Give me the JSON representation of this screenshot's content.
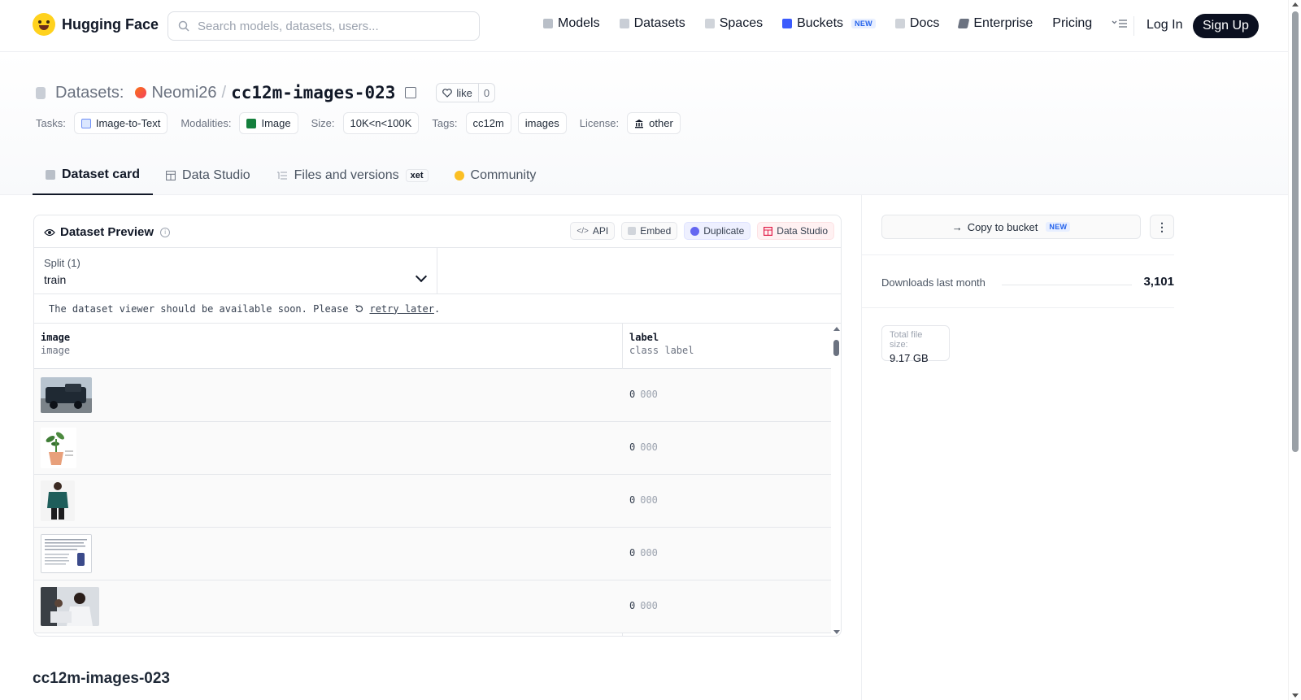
{
  "nav": {
    "brand": "Hugging Face",
    "search_placeholder": "Search models, datasets, users...",
    "links": {
      "models": "Models",
      "datasets": "Datasets",
      "spaces": "Spaces",
      "buckets": "Buckets",
      "buckets_badge": "NEW",
      "docs": "Docs",
      "enterprise": "Enterprise",
      "pricing": "Pricing"
    },
    "login": "Log In",
    "signup": "Sign Up"
  },
  "repo": {
    "type_label": "Datasets:",
    "owner": "Neomi26",
    "separator": "/",
    "name": "cc12m-images-023",
    "like_label": "like",
    "like_count": "0"
  },
  "meta": {
    "tasks_label": "Tasks:",
    "task": "Image-to-Text",
    "modalities_label": "Modalities:",
    "modality": "Image",
    "size_label": "Size:",
    "size": "10K<n<100K",
    "tags_label": "Tags:",
    "tags": [
      "cc12m",
      "images"
    ],
    "license_label": "License:",
    "license": "other"
  },
  "tabs": {
    "dataset_card": "Dataset card",
    "data_studio": "Data Studio",
    "files": "Files and versions",
    "files_badge": "xet",
    "community": "Community"
  },
  "preview": {
    "title": "Dataset Preview",
    "actions": {
      "api": "API",
      "embed": "Embed",
      "duplicate": "Duplicate",
      "data_studio": "Data Studio"
    },
    "split_label": "Split (1)",
    "split_value": "train",
    "notice": "The dataset viewer should be available soon. Please",
    "retry": "retry later",
    "notice_end": ".",
    "columns": [
      {
        "name": "image",
        "type": "image"
      },
      {
        "name": "label",
        "type": "class label"
      }
    ],
    "rows": [
      {
        "thumb": "truck",
        "label_id": "0",
        "label_name": "000"
      },
      {
        "thumb": "plant",
        "label_id": "0",
        "label_name": "000"
      },
      {
        "thumb": "jacket",
        "label_id": "0",
        "label_name": "000"
      },
      {
        "thumb": "document",
        "label_id": "0",
        "label_name": "000"
      },
      {
        "thumb": "people",
        "label_id": "0",
        "label_name": "000"
      }
    ]
  },
  "readme_title": "cc12m-images-023",
  "sidebar": {
    "copy_bucket": "Copy to bucket",
    "copy_bucket_badge": "NEW",
    "downloads_label": "Downloads last month",
    "downloads_value": "3,101",
    "total_size_label": "Total file size:",
    "total_size_value": "9.17 GB"
  },
  "colors": {
    "accent": "#ffd21e",
    "signup_bg": "#0b1020",
    "new_badge": "#2563eb"
  }
}
